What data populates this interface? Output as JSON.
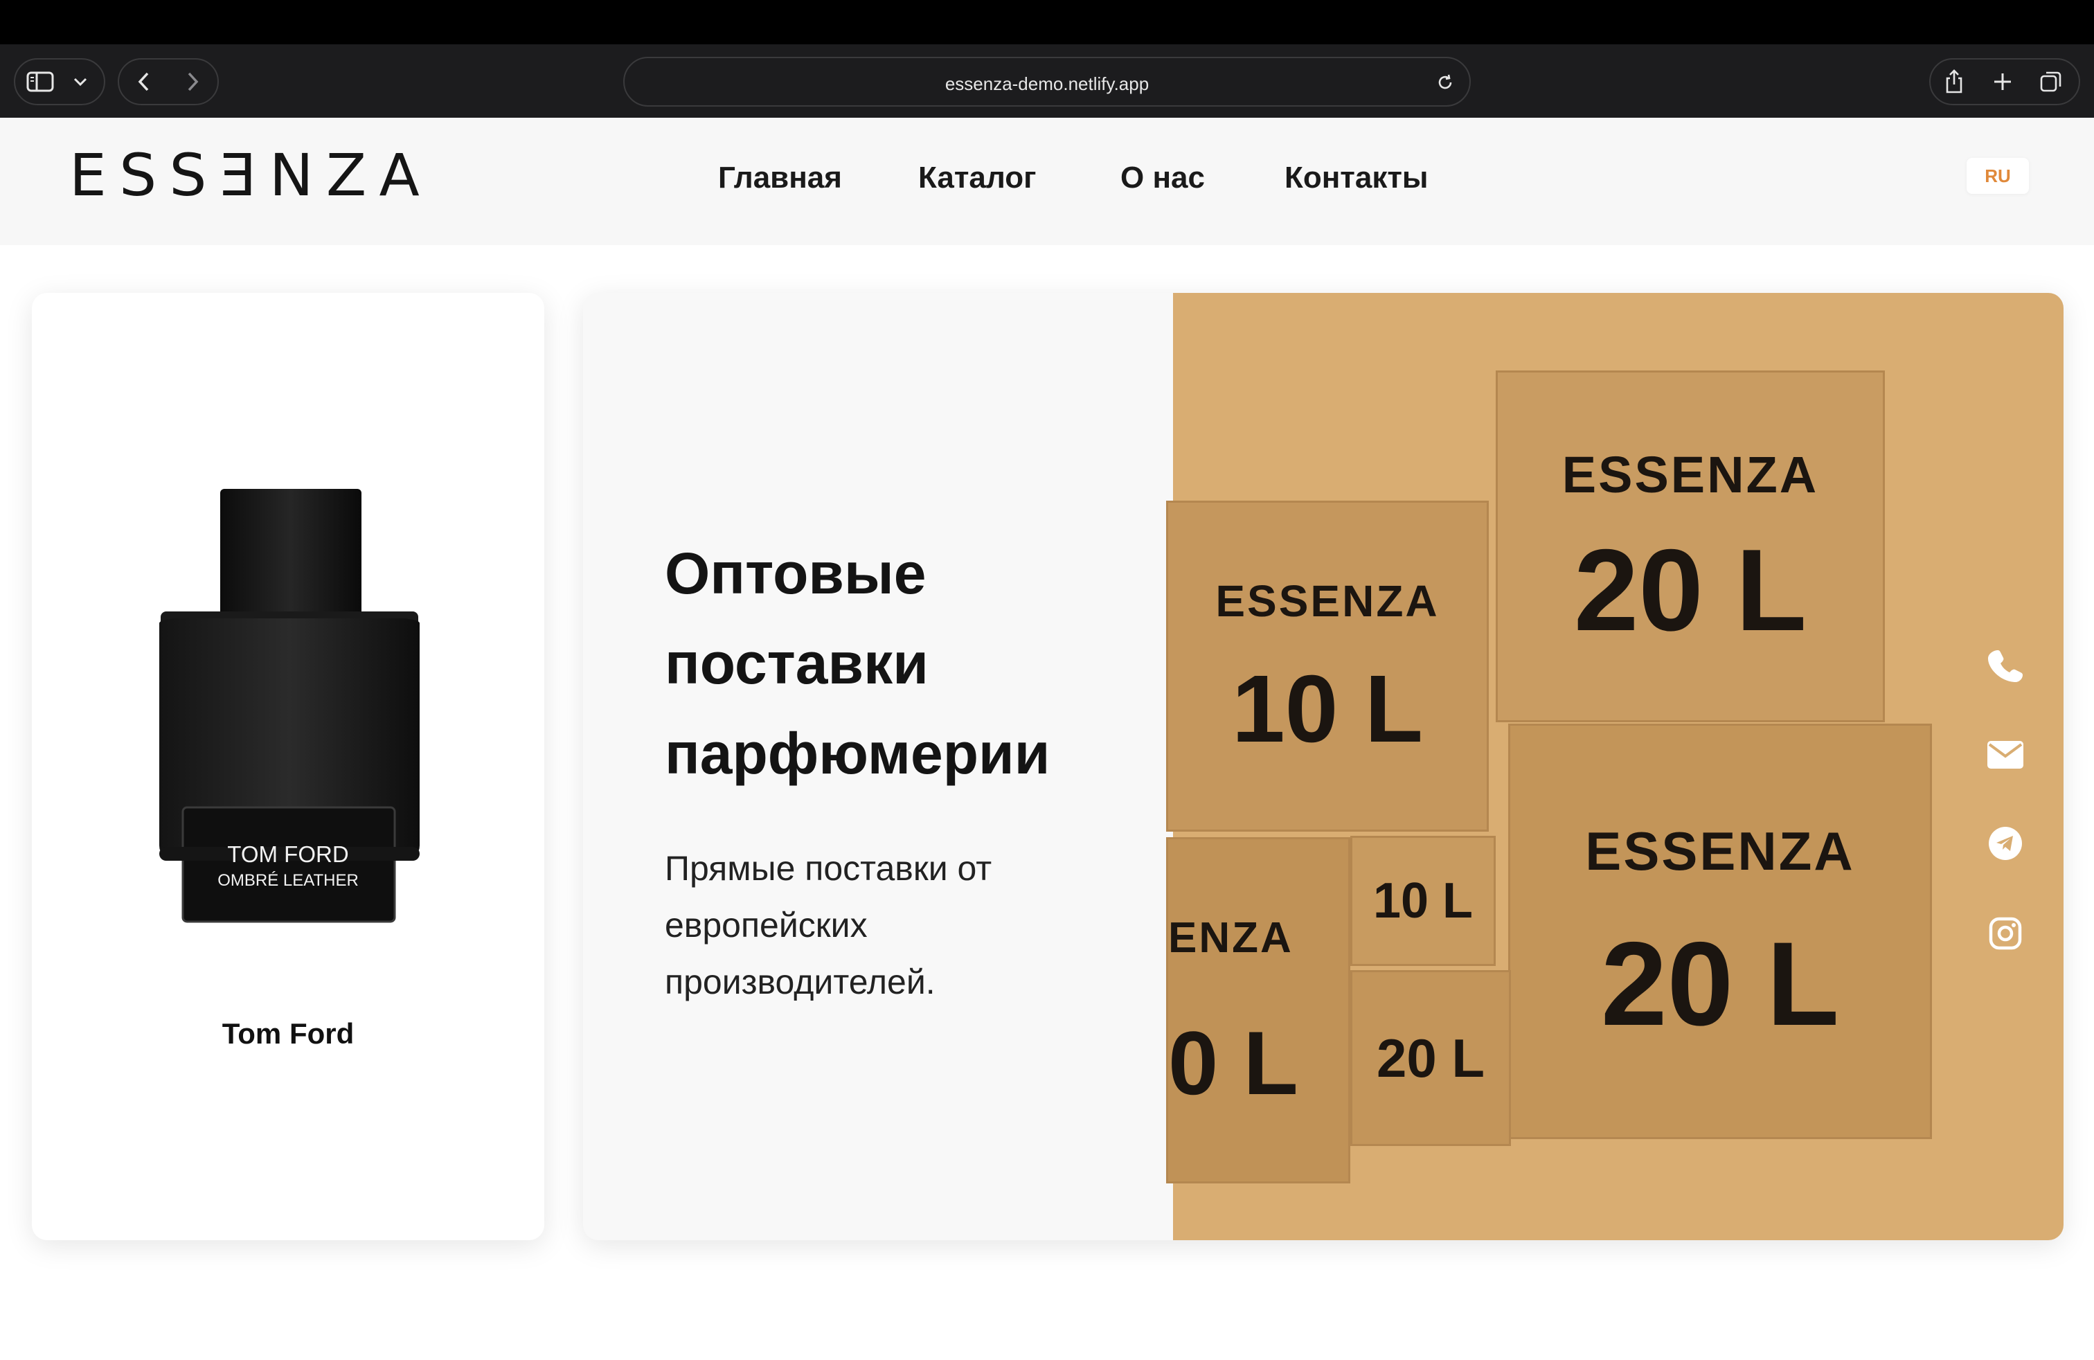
{
  "browser": {
    "url": "essenza-demo.netlify.app"
  },
  "header": {
    "logo_text": "ESSƎNZA",
    "nav": [
      "Главная",
      "Каталог",
      "О нас",
      "Контакты"
    ],
    "lang": "RU",
    "accent_color": "#e0893a"
  },
  "product": {
    "bottle_brand": "TOM FORD",
    "bottle_name": "OMBRÉ LEATHER",
    "name": "Tom Ford"
  },
  "hero": {
    "title_lines": [
      "Оптовые",
      "поставки",
      "парфюмерии"
    ],
    "subtitle_lines": [
      "Прямые поставки от",
      "европейских",
      "производителей."
    ],
    "boxes": [
      {
        "brand": "ESSENZA",
        "volume": "20 L"
      },
      {
        "brand": "ESSENZA",
        "volume": "10 L"
      },
      {
        "brand": "ESSENZA",
        "volume": "20 L"
      },
      {
        "brand": "ENZA",
        "volume": "0 L"
      },
      {
        "brand": "",
        "volume": "10 L"
      },
      {
        "brand": "",
        "volume": "20 L"
      }
    ]
  },
  "contacts": {
    "icons": [
      "phone-icon",
      "mail-icon",
      "telegram-icon",
      "instagram-icon"
    ]
  }
}
